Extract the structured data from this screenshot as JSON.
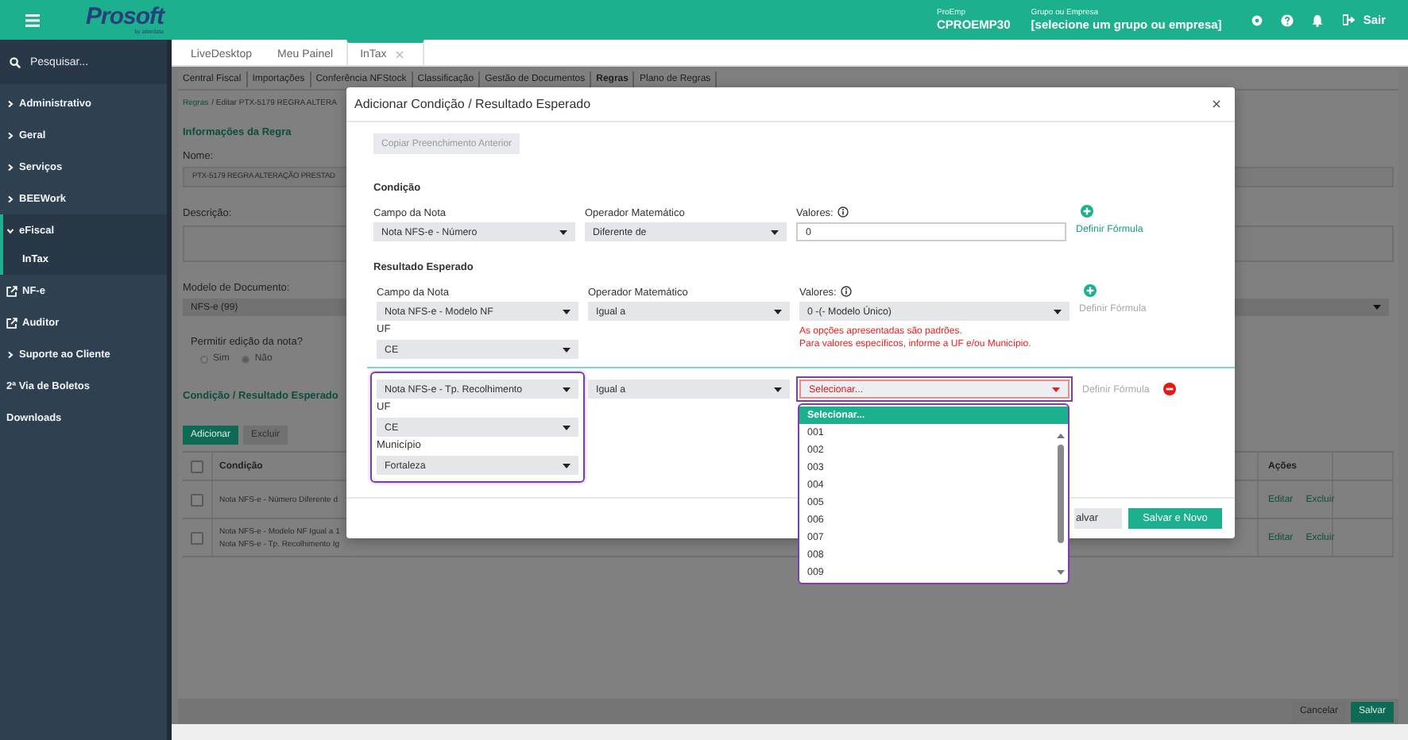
{
  "topbar": {
    "logo": "Prosoft",
    "logo_tagline": "by alterdata",
    "company": {
      "label": "ProEmp",
      "value": "CPROEMP30"
    },
    "group": {
      "label": "Grupo ou Empresa",
      "value": "[selecione um grupo ou empresa]"
    },
    "logout": "Sair"
  },
  "sidebar": {
    "search_placeholder": "Pesquisar...",
    "items": [
      {
        "label": "Administrativo",
        "kind": "group",
        "expanded": false
      },
      {
        "label": "Geral",
        "kind": "group",
        "expanded": false
      },
      {
        "label": "Serviços",
        "kind": "group",
        "expanded": false
      },
      {
        "label": "BEEWork",
        "kind": "group",
        "expanded": false
      },
      {
        "label": "eFiscal",
        "kind": "group",
        "expanded": true,
        "children": [
          {
            "label": "InTax"
          }
        ]
      },
      {
        "label": "NF-e",
        "kind": "external"
      },
      {
        "label": "Auditor",
        "kind": "external"
      },
      {
        "label": "Suporte ao Cliente",
        "kind": "group",
        "expanded": false
      },
      {
        "label": "2ª Via de Boletos",
        "kind": "plain"
      },
      {
        "label": "Downloads",
        "kind": "plain"
      }
    ]
  },
  "tabs": [
    {
      "label": "LiveDesktop",
      "selected": false,
      "closable": false
    },
    {
      "label": "Meu Painel",
      "selected": false,
      "closable": false
    },
    {
      "label": "InTax",
      "selected": true,
      "closable": true
    }
  ],
  "submenu": [
    {
      "label": "Central Fiscal",
      "selected": false
    },
    {
      "label": "Importações",
      "selected": false
    },
    {
      "label": "Conferência NFStock",
      "selected": false
    },
    {
      "label": "Classificação",
      "selected": false
    },
    {
      "label": "Gestão de Documentos",
      "selected": false
    },
    {
      "label": "Regras",
      "selected": true
    },
    {
      "label": "Plano de Regras",
      "selected": false
    }
  ],
  "page": {
    "breadcrumb": {
      "link": "Regras",
      "current": "/ Editar PTX-5179 REGRA ALTERA"
    },
    "section_title": "Informações da Regra",
    "name": {
      "label": "Nome:",
      "value": "PTX-5179 REGRA ALTERAÇÃO PRESTAD"
    },
    "description": {
      "label": "Descrição:"
    },
    "document_model": {
      "label": "Modelo de Documento:",
      "value": "NFS-e (99)"
    },
    "allow_edit": {
      "label": "Permitir edição da nota?",
      "options": [
        {
          "label": "Sim",
          "selected": false
        },
        {
          "label": "Não",
          "selected": true
        }
      ]
    },
    "conditions_title": "Condição / Resultado Esperado",
    "buttons": [
      {
        "label": "Adicionar",
        "kind": "primary"
      },
      {
        "label": "Excluir",
        "kind": "secondary"
      }
    ],
    "table": {
      "columns": [
        "Condição",
        "Ações"
      ],
      "header_checked": false,
      "rows": [
        {
          "checked": false,
          "lines": [
            "Nota NFS-e - Número Diferente d"
          ],
          "actions": [
            "Editar",
            "Excluir"
          ]
        },
        {
          "checked": false,
          "lines": [
            "Nota NFS-e - Modelo NF Igual a 1",
            "Nota NFS-e - Tp. Recolhimento Ig"
          ],
          "actions": [
            "Editar",
            "Excluir"
          ]
        }
      ]
    },
    "footer_buttons": [
      {
        "label": "Cancelar",
        "kind": "secondary"
      },
      {
        "label": "Salvar",
        "kind": "primary"
      }
    ]
  },
  "modal": {
    "title": "Adicionar Condição / Resultado Esperado",
    "copy_button": "Copiar Preenchimento Anterior",
    "sections": [
      {
        "title": "Condição",
        "rows": [
          {
            "field": {
              "label": "Campo da Nota",
              "value": "Nota NFS-e - Número"
            },
            "operator": {
              "label": "Operador Matemático",
              "value": "Diferente de"
            },
            "values": {
              "label": "Valores:",
              "info": true,
              "kind": "input",
              "value": "0"
            },
            "formula_link": {
              "label": "Definir Fórmula",
              "disabled": false
            },
            "addable": true,
            "removable": false
          }
        ]
      },
      {
        "title": "Resultado Esperado",
        "rows": [
          {
            "field": {
              "label": "Campo da Nota",
              "value": "Nota NFS-e - Modelo NF"
            },
            "operator": {
              "label": "Operador Matemático",
              "value": "Igual a"
            },
            "values": {
              "label": "Valores:",
              "info": true,
              "kind": "select",
              "value": "0 -(- Modelo Único)",
              "invalid": false
            },
            "uf": {
              "label": "UF",
              "value": "CE"
            },
            "note": [
              "As opções apresentadas são padrões.",
              "Para valores específicos, informe a UF e/ou Município."
            ],
            "formula_link": {
              "label": "Definir Fórmula",
              "disabled": true
            },
            "addable": true,
            "removable": false,
            "highlighted": false
          },
          {
            "field": {
              "value": "Nota NFS-e - Tp. Recolhimento"
            },
            "operator": {
              "value": "Igual a"
            },
            "values": {
              "kind": "select",
              "placeholder": "Selecionar...",
              "invalid": true,
              "open": true,
              "options": [
                {
                  "label": "Selecionar...",
                  "selected": true
                },
                {
                  "label": "001",
                  "selected": false
                },
                {
                  "label": "002",
                  "selected": false
                },
                {
                  "label": "003",
                  "selected": false
                },
                {
                  "label": "004",
                  "selected": false
                },
                {
                  "label": "005",
                  "selected": false
                },
                {
                  "label": "006",
                  "selected": false
                },
                {
                  "label": "007",
                  "selected": false
                },
                {
                  "label": "008",
                  "selected": false
                },
                {
                  "label": "009",
                  "selected": false
                }
              ]
            },
            "uf": {
              "label": "UF",
              "value": "CE"
            },
            "municipality": {
              "label": "Município",
              "value": "Fortaleza"
            },
            "formula_link": {
              "label": "Definir Fórmula",
              "disabled": true
            },
            "addable": false,
            "removable": true,
            "highlighted": true
          }
        ]
      }
    ],
    "footer_buttons": [
      {
        "label": "alvar",
        "kind": "secondary"
      },
      {
        "label": "Salvar e Novo",
        "kind": "primary"
      }
    ]
  }
}
